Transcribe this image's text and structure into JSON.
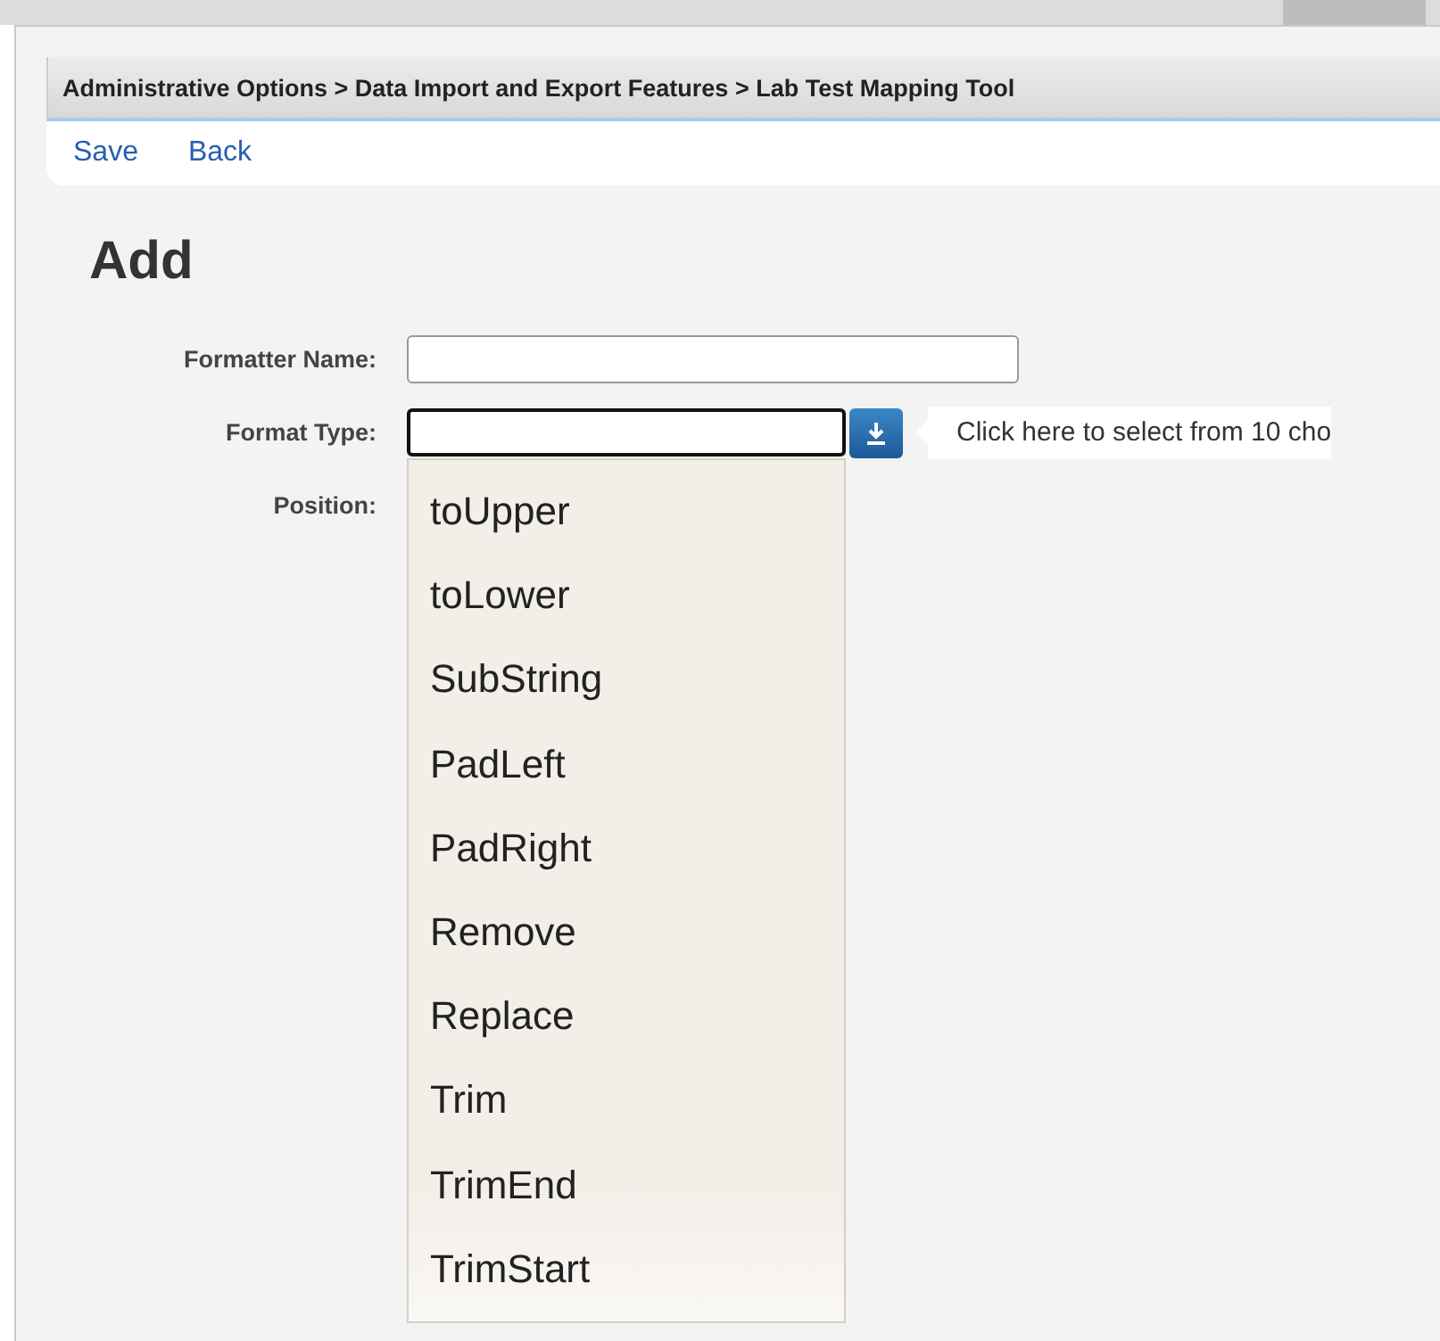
{
  "breadcrumb": "Administrative Options > Data Import and Export Features > Lab Test Mapping Tool",
  "toolbar": [
    {
      "label": "Save"
    },
    {
      "label": "Back"
    }
  ],
  "heading": "Add",
  "fields": [
    {
      "label": "Formatter Name:",
      "kind": "text"
    },
    {
      "label": "Format Type:",
      "kind": "combo",
      "focused": true
    },
    {
      "label": "Position:",
      "kind": "hidden"
    }
  ],
  "dropdown": {
    "options": [
      "toUpper",
      "toLower",
      "SubString",
      "PadLeft",
      "PadRight",
      "Remove",
      "Replace",
      "Trim",
      "TrimEnd",
      "TrimStart"
    ]
  },
  "tooltip": "Click here to select from 10 cho"
}
